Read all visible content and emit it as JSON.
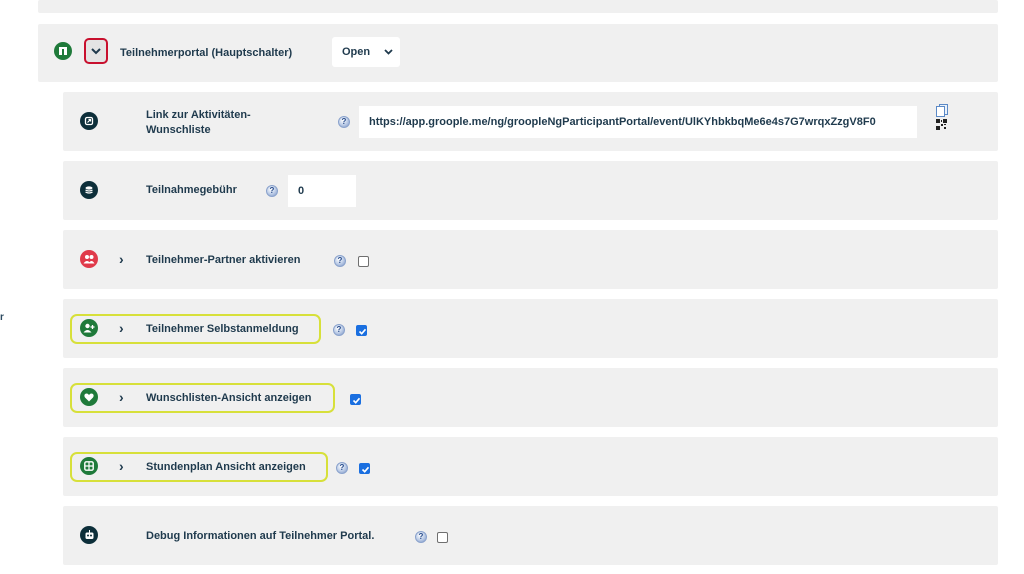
{
  "side_stub": "r",
  "main": {
    "label": "Teilnehmerportal (Hauptschalter)",
    "select_value": "Open",
    "icon": "portal-icon"
  },
  "rows": {
    "link": {
      "label_line1": "Link zur Aktivitäten-",
      "label_line2": "Wunschliste",
      "url": "https://app.groople.me/ng/groopleNgParticipantPortal/event/UlKYhbkbqMe6e4s7G7wrqxZzgV8F0",
      "icon": "external-link-icon"
    },
    "fee": {
      "label": "Teilnahmegebühr",
      "value": "0",
      "icon": "coins-icon"
    },
    "partner": {
      "label": "Teilnehmer-Partner aktivieren",
      "checked": false,
      "icon": "users-icon"
    },
    "selfreg": {
      "label": "Teilnehmer Selbstanmeldung",
      "checked": true,
      "icon": "user-plus-icon"
    },
    "wishlist": {
      "label": "Wunschlisten-Ansicht anzeigen",
      "checked": true,
      "icon": "heart-icon"
    },
    "schedule": {
      "label": "Stundenplan Ansicht anzeigen",
      "checked": true,
      "icon": "calendar-icon"
    },
    "debug": {
      "label": "Debug Informationen auf Teilnehmer Portal.",
      "checked": false,
      "icon": "robot-icon"
    }
  },
  "colors": {
    "accent_green": "#1f7a3a",
    "dark_teal": "#0d2f3a",
    "red": "#e03a4a",
    "highlight": "#d7e03a",
    "chevron_border": "#c8102e",
    "checkbox_blue": "#1a6fe0"
  }
}
